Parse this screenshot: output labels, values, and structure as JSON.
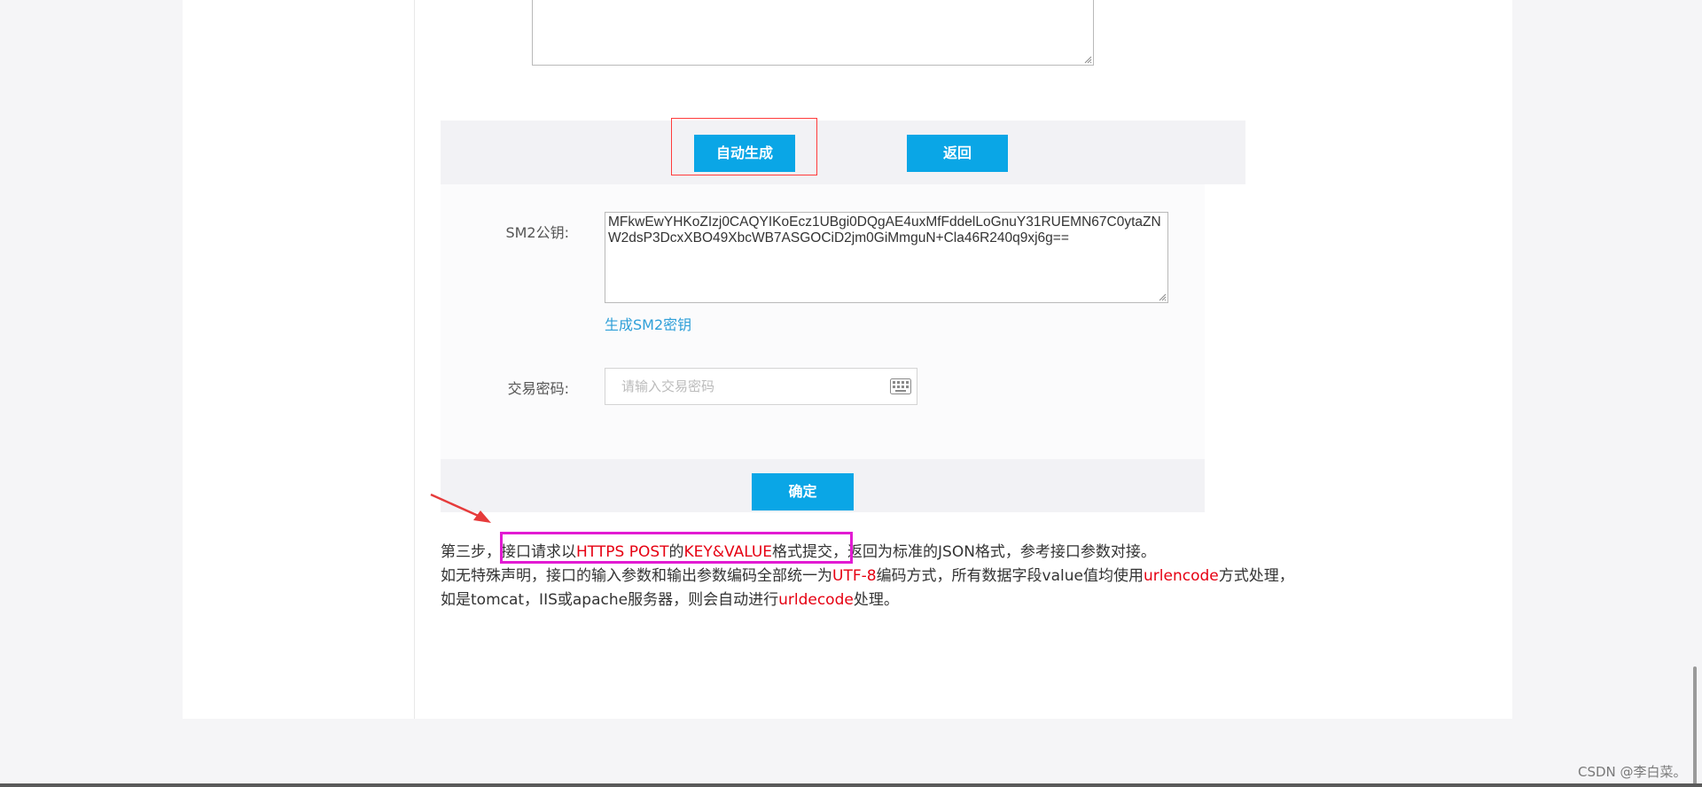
{
  "buttons": {
    "auto_generate": "自动生成",
    "back": "返回",
    "confirm": "确定"
  },
  "form": {
    "sm2_label": "SM2公钥:",
    "sm2_value": "MFkwEwYHKoZIzj0CAQYIKoEcz1UBgi0DQgAE4uxMfFddelLoGnuY31RUEMN67C0ytaZNW2dsP3DcxXBO49XbcWB7ASGOCiD2jm0GiMmguN+Cla46R240q9xj6g==",
    "gen_link": "生成SM2密钥",
    "pwd_label": "交易密码:",
    "pwd_placeholder": "请输入交易密码"
  },
  "instructions": {
    "line1": [
      {
        "text": "第三步，",
        "red": false
      },
      {
        "text": "接口请求以",
        "red": false
      },
      {
        "text": "HTTPS POST",
        "red": true
      },
      {
        "text": "的",
        "red": false
      },
      {
        "text": "KEY&VALUE",
        "red": true
      },
      {
        "text": "格式提交，",
        "red": false
      },
      {
        "text": "返回为标准的JSON格式，参考接口参数对接。",
        "red": false
      }
    ],
    "line2": [
      {
        "text": "如无特殊声明，接口的输入参数和输出参数编码全部统一为",
        "red": false
      },
      {
        "text": "UTF-8",
        "red": true
      },
      {
        "text": "编码方式，所有数据字段value值均使用",
        "red": false
      },
      {
        "text": "urlencode",
        "red": true
      },
      {
        "text": "方式处理，",
        "red": false
      }
    ],
    "line3": [
      {
        "text": "如是tomcat，IIS或apache服务器，则会自动进行",
        "red": false
      },
      {
        "text": "urldecode",
        "red": true
      },
      {
        "text": "处理。",
        "red": false
      }
    ]
  },
  "watermark": "CSDN @李白菜。",
  "icons": {
    "keyboard": "keyboard-icon",
    "resize": "resize-grip-icon",
    "arrow": "annotation-arrow"
  },
  "colors": {
    "accent": "#0aa6e6",
    "emphasis": "#e60012",
    "link": "#2e9fd8",
    "annotation_red": "#ff3b3b",
    "annotation_magenta": "#e21bd3"
  }
}
